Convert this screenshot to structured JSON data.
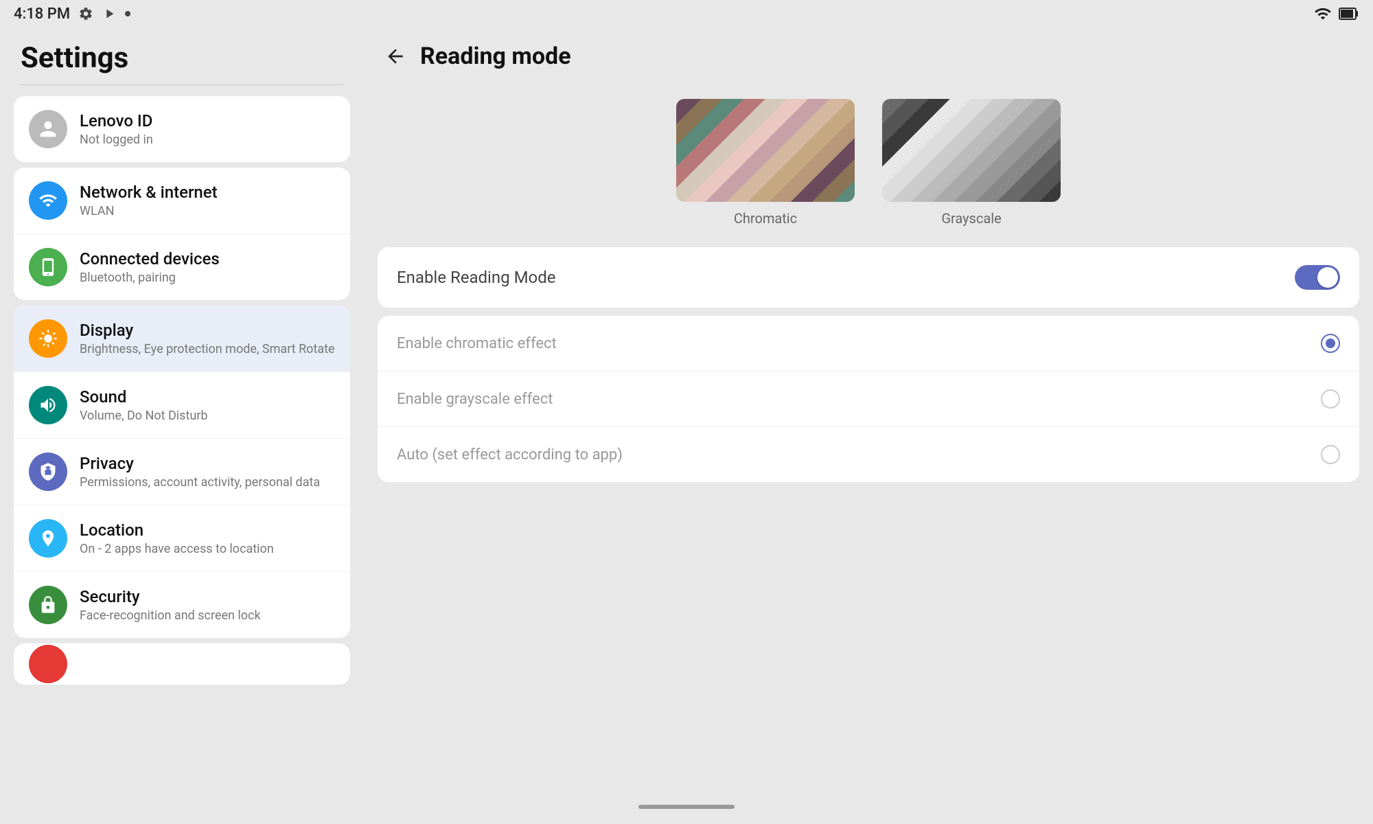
{
  "statusBar": {
    "time": "4:18 PM",
    "wifi": true,
    "battery": true
  },
  "settingsPanel": {
    "title": "Settings",
    "items": [
      {
        "id": "lenovo-id",
        "label": "Lenovo ID",
        "sublabel": "Not logged in",
        "iconColor": "gray",
        "iconType": "person"
      },
      {
        "id": "network",
        "label": "Network & internet",
        "sublabel": "WLAN",
        "iconColor": "blue",
        "iconType": "wifi"
      },
      {
        "id": "connected-devices",
        "label": "Connected devices",
        "sublabel": "Bluetooth, pairing",
        "iconColor": "green",
        "iconType": "devices"
      },
      {
        "id": "display",
        "label": "Display",
        "sublabel": "Brightness, Eye protection mode, Smart Rotate",
        "iconColor": "orange",
        "iconType": "display",
        "active": true
      },
      {
        "id": "sound",
        "label": "Sound",
        "sublabel": "Volume, Do Not Disturb",
        "iconColor": "teal",
        "iconType": "sound"
      },
      {
        "id": "privacy",
        "label": "Privacy",
        "sublabel": "Permissions, account activity, personal data",
        "iconColor": "indigo",
        "iconType": "privacy"
      },
      {
        "id": "location",
        "label": "Location",
        "sublabel": "On - 2 apps have access to location",
        "iconColor": "pin",
        "iconType": "location"
      },
      {
        "id": "security",
        "label": "Security",
        "sublabel": "Face-recognition and screen lock",
        "iconColor": "dark-green",
        "iconType": "security"
      }
    ],
    "partialItem": {
      "iconColor": "red"
    }
  },
  "readingMode": {
    "backLabel": "Back",
    "title": "Reading mode",
    "chromaticLabel": "Chromatic",
    "grayscaleLabel": "Grayscale",
    "enableLabel": "Enable Reading Mode",
    "toggleOn": true,
    "options": [
      {
        "id": "chromatic",
        "label": "Enable chromatic effect",
        "selected": true
      },
      {
        "id": "grayscale",
        "label": "Enable grayscale effect",
        "selected": false
      },
      {
        "id": "auto",
        "label": "Auto (set effect according to app)",
        "selected": false
      }
    ]
  }
}
